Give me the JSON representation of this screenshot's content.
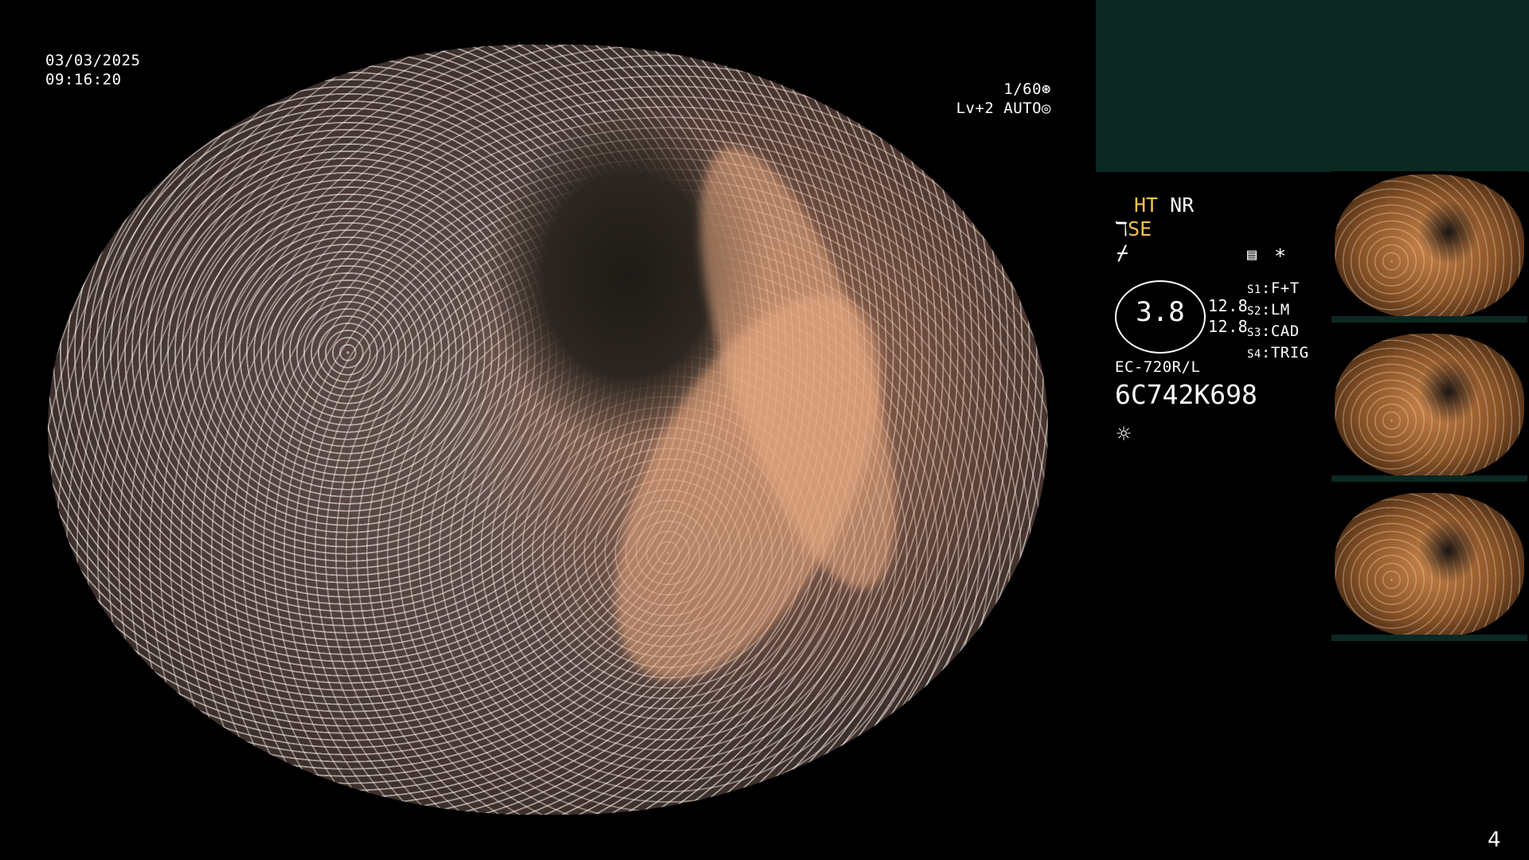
{
  "overlay": {
    "date": "03/03/2025",
    "time": "09:16:20",
    "shutter": "1/60",
    "level": "Lv+2",
    "auto": "AUTO"
  },
  "side_panel": {
    "ht": "HT",
    "nr": "NR",
    "se": "SE",
    "dial_value": "3.8",
    "values": [
      "12.8",
      "12.8"
    ],
    "star": "*",
    "switches": [
      {
        "key": "S1",
        "label": "F+T"
      },
      {
        "key": "S2",
        "label": "LM"
      },
      {
        "key": "S3",
        "label": "CAD"
      },
      {
        "key": "S4",
        "label": "TRIG"
      }
    ],
    "scope_model": "EC-720R/L",
    "serial": "6C742K698"
  },
  "thumbnails": [
    {
      "name": "thumbnail-1"
    },
    {
      "name": "thumbnail-2"
    },
    {
      "name": "thumbnail-3"
    }
  ],
  "page_number": "4",
  "colors": {
    "accent_yellow": "#f2c14a",
    "panel_teal": "#0b2823",
    "background": "#000000"
  },
  "icons": [
    "shutter-icon",
    "iris-icon",
    "scope-icon",
    "freeze-icon",
    "memory-icon",
    "brightness-icon"
  ]
}
